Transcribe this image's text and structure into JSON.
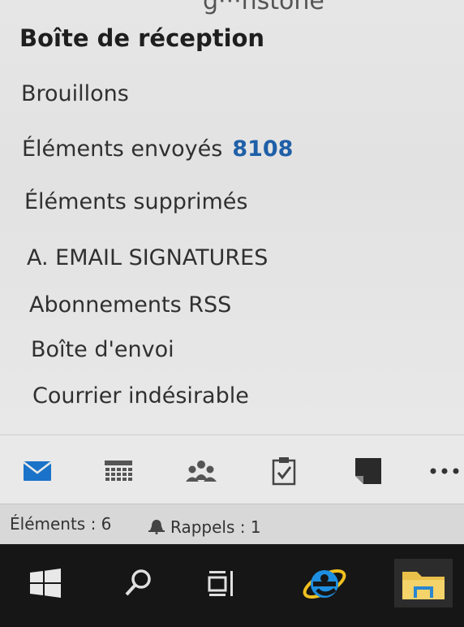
{
  "account": {
    "name_cut": "g···hstone"
  },
  "folders": [
    {
      "label": "Boîte de réception",
      "count": ""
    },
    {
      "label": "Brouillons",
      "count": ""
    },
    {
      "label": "Éléments envoyés",
      "count": "8108"
    },
    {
      "label": "Éléments supprimés",
      "count": ""
    },
    {
      "label": "A. EMAIL SIGNATURES",
      "count": ""
    },
    {
      "label": "Abonnements RSS",
      "count": ""
    },
    {
      "label": "Boîte d'envoi",
      "count": ""
    },
    {
      "label": "Courrier indésirable",
      "count": ""
    }
  ],
  "nav": {
    "items": [
      {
        "name": "mail",
        "icon": "envelope-icon"
      },
      {
        "name": "calendar",
        "icon": "calendar-icon"
      },
      {
        "name": "people",
        "icon": "people-icon"
      },
      {
        "name": "tasks",
        "icon": "tasks-icon"
      },
      {
        "name": "notes",
        "icon": "note-icon"
      },
      {
        "name": "more",
        "icon": "more-icon"
      }
    ],
    "active": "mail"
  },
  "status": {
    "items_text": "Éléments : 6",
    "reminders_text": "Rappels : 1"
  },
  "taskbar": {
    "items": [
      "start",
      "search",
      "task-view",
      "internet-explorer",
      "file-explorer"
    ]
  },
  "colors": {
    "accent": "#1f5fa8",
    "mail_icon": "#1a73c8",
    "taskbar_bg": "#161616",
    "ie_blue": "#1e8fe0",
    "ie_ring": "#f0c020",
    "folder_yellow": "#e8c04a"
  }
}
